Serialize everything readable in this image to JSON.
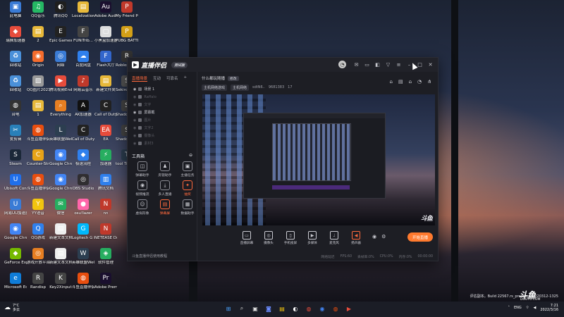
{
  "desktop": {
    "icons": [
      {
        "label": "此电脑",
        "color": "#3a7bd5",
        "glyph": "▣"
      },
      {
        "label": "QQ音乐",
        "color": "#25b864",
        "glyph": "♫"
      },
      {
        "label": "腾讯QQ",
        "color": "#1f1f1f",
        "glyph": "◐"
      },
      {
        "label": "Localization",
        "color": "#e8b93a",
        "glyph": "▤"
      },
      {
        "label": "Adobe Audit...",
        "color": "#1a0f2e",
        "glyph": "Au"
      },
      {
        "label": "My Friend Pedro",
        "color": "#c0392b",
        "glyph": "P"
      },
      {
        "label": "瑞狮加速器",
        "color": "#e74c3c",
        "glyph": "◆"
      },
      {
        "label": "2",
        "color": "#e8b93a",
        "glyph": "▤"
      },
      {
        "label": "Epic Games Launcher",
        "color": "#222",
        "glyph": "E"
      },
      {
        "label": "FUNiTrib...",
        "color": "#444",
        "glyph": "F"
      },
      {
        "label": "小黑盒加速器",
        "color": "#ddd",
        "glyph": "▢"
      },
      {
        "label": "PUBG BATTLEGR...",
        "color": "#d4a017",
        "glyph": "P"
      },
      {
        "label": "回收站",
        "color": "#4a90d9",
        "glyph": "♻"
      },
      {
        "label": "Origin",
        "color": "#f56c2d",
        "glyph": "◉"
      },
      {
        "label": "网络",
        "color": "#3a7bd5",
        "glyph": "◎"
      },
      {
        "label": "百度网盘",
        "color": "#2f80ed",
        "glyph": "☁"
      },
      {
        "label": "Flash大厅",
        "color": "#3366cc",
        "glyph": "F"
      },
      {
        "label": "Roblox Player",
        "color": "#333",
        "glyph": "R"
      },
      {
        "label": "回收站",
        "color": "#4a90d9",
        "glyph": "♻"
      },
      {
        "label": "QQ图片20210323...",
        "color": "#999",
        "glyph": "▨"
      },
      {
        "label": "腾讯视频End",
        "color": "#e74c3c",
        "glyph": "▶"
      },
      {
        "label": "网易云音乐",
        "color": "#c0392b",
        "glyph": "♪"
      },
      {
        "label": "新建文件夹",
        "color": "#e8b93a",
        "glyph": "▤"
      },
      {
        "label": "Sekiro Shadows...",
        "color": "#555",
        "glyph": "S"
      },
      {
        "label": "台电",
        "color": "#333",
        "glyph": "◍"
      },
      {
        "label": "1",
        "color": "#e8b93a",
        "glyph": "▤"
      },
      {
        "label": "Everything",
        "color": "#e67e22",
        "glyph": "⌕"
      },
      {
        "label": "AK加速器",
        "color": "#111",
        "glyph": "A"
      },
      {
        "label": "Call of Duty Black Op...",
        "color": "#222",
        "glyph": "C"
      },
      {
        "label": "Shadow Warrior 3",
        "color": "#444",
        "glyph": "S"
      },
      {
        "label": "爱剪辑",
        "color": "#2980b9",
        "glyph": "✂"
      },
      {
        "label": "斗鱼直播伴侣",
        "color": "#e84e0f",
        "glyph": "◍"
      },
      {
        "label": "英雄联盟WeGame",
        "color": "#2c3e50",
        "glyph": "L"
      },
      {
        "label": "Call of Duty Vanguard",
        "color": "#222",
        "glyph": "C"
      },
      {
        "label": "EA",
        "color": "#e74c3c",
        "glyph": "EA"
      },
      {
        "label": "Shadow Warrior 2",
        "color": "#444",
        "glyph": "S"
      },
      {
        "label": "Steam",
        "color": "#1b2838",
        "glyph": "S"
      },
      {
        "label": "Counter-Strike Global Of...",
        "color": "#e8a317",
        "glyph": "C"
      },
      {
        "label": "Google Chrome",
        "color": "#4285f4",
        "glyph": "◉"
      },
      {
        "label": "极速流程",
        "color": "#2f80ed",
        "glyph": "◆"
      },
      {
        "label": "加速器",
        "color": "#27ae60",
        "glyph": "⚡"
      },
      {
        "label": "tool Tsuba...",
        "color": "#2c3e50",
        "glyph": "T"
      },
      {
        "label": "Ubisoft Connect",
        "color": "#1f6feb",
        "glyph": "U"
      },
      {
        "label": "斗鱼直播伴侣工具",
        "color": "#e84e0f",
        "glyph": "◍"
      },
      {
        "label": "Google Chrome",
        "color": "#4285f4",
        "glyph": "◉"
      },
      {
        "label": "OBS Studio",
        "color": "#302e31",
        "glyph": "◎"
      },
      {
        "label": "腾讯文档",
        "color": "#2f80ed",
        "glyph": "▥"
      },
      {
        "label": "",
        "color": "transparent",
        "glyph": ""
      },
      {
        "label": "网易UU加速器",
        "color": "#3a7bd5",
        "glyph": "U"
      },
      {
        "label": "YY语音",
        "color": "#f1c40f",
        "glyph": "Y"
      },
      {
        "label": "微信",
        "color": "#27ae60",
        "glyph": "✉"
      },
      {
        "label": "osu!lazer",
        "color": "#ff66aa",
        "glyph": "●"
      },
      {
        "label": "nn",
        "color": "#c0392b",
        "glyph": "N"
      },
      {
        "label": "",
        "color": "transparent",
        "glyph": ""
      },
      {
        "label": "Google Chrome",
        "color": "#4285f4",
        "glyph": "◉"
      },
      {
        "label": "QQ游戏",
        "color": "#2f80ed",
        "glyph": "Q"
      },
      {
        "label": "新建文本文档.txt",
        "color": "#eee",
        "glyph": "▤"
      },
      {
        "label": "Logitech G HUB",
        "color": "#00b8fc",
        "glyph": "G"
      },
      {
        "label": "NETEASE Driver",
        "color": "#c0392b",
        "glyph": "N"
      },
      {
        "label": "",
        "color": "transparent",
        "glyph": ""
      },
      {
        "label": "GeForce Experience",
        "color": "#76b900",
        "glyph": "◆"
      },
      {
        "label": "游戏开放平台",
        "color": "#e67e22",
        "glyph": "◎"
      },
      {
        "label": "新建文本文档(2).txt",
        "color": "#eee",
        "glyph": "▤"
      },
      {
        "label": "英雄联盟WeGame",
        "color": "#2c3e50",
        "glyph": "W"
      },
      {
        "label": "软件管理",
        "color": "#27ae60",
        "glyph": "◈"
      },
      {
        "label": "",
        "color": "transparent",
        "glyph": ""
      },
      {
        "label": "Microsoft Edge",
        "color": "#0f7cd8",
        "glyph": "e"
      },
      {
        "label": "Randisp",
        "color": "#444",
        "glyph": "R"
      },
      {
        "label": "Key2Xinput",
        "color": "#444",
        "glyph": "K"
      },
      {
        "label": "斗鱼直播伴侣",
        "color": "#e84e0f",
        "glyph": "◍"
      },
      {
        "label": "Adobe Premie...",
        "color": "#1a0f2e",
        "glyph": "Pr"
      },
      {
        "label": "",
        "color": "transparent",
        "glyph": ""
      }
    ]
  },
  "app": {
    "title": "直播伴侣",
    "version_badge": "测试版",
    "tabs": [
      "直播场景",
      "互动",
      "可靠名"
    ],
    "scenes": [
      {
        "label": "场景 1",
        "dim": false
      },
      {
        "label": "Raffalo",
        "dim": true
      },
      {
        "label": "文字",
        "dim": true
      },
      {
        "label": "屏幕截",
        "dim": false
      },
      {
        "label": "图片",
        "dim": true
      },
      {
        "label": "文字2",
        "dim": true
      },
      {
        "label": "摄像头",
        "dim": true
      },
      {
        "label": "素材3",
        "dim": true
      }
    ],
    "toolbox_title": "工具箱",
    "tools": [
      {
        "label": "弹幕助手",
        "hot": false,
        "glyph": "◫"
      },
      {
        "label": "房管助手",
        "hot": false,
        "glyph": "♟"
      },
      {
        "label": "主播任务",
        "hot": false,
        "glyph": "▣"
      },
      {
        "label": "视频推流",
        "hot": false,
        "glyph": "◉"
      },
      {
        "label": "多人直播",
        "hot": false,
        "glyph": "⤓"
      },
      {
        "label": "抽奖",
        "hot": true,
        "glyph": "✦"
      },
      {
        "label": "虚拟形象",
        "hot": false,
        "glyph": "☺"
      },
      {
        "label": "弹幕屏",
        "hot": true,
        "glyph": "▤"
      },
      {
        "label": "数据助手",
        "hot": false,
        "glyph": "▦"
      }
    ],
    "footer_notice": "斗鱼直播伴侣使用教程",
    "room_title": "什么都玩随播",
    "room_chip": "修改",
    "room_tags": [
      "主机网络游戏",
      "主机网络"
    ],
    "room_stats": [
      "sdtN6..",
      "9681383",
      "17"
    ],
    "controls": [
      {
        "label": "直播屏幕",
        "hot": false,
        "glyph": "▭"
      },
      {
        "label": "摄像头",
        "hot": false,
        "glyph": "◎"
      },
      {
        "label": "手机投屏",
        "hot": false,
        "glyph": "▯"
      },
      {
        "label": "多媒体",
        "hot": false,
        "glyph": "▶"
      },
      {
        "label": "麦克风",
        "hot": false,
        "glyph": "♩"
      },
      {
        "label": "扬声器",
        "hot": true,
        "glyph": "◀"
      }
    ],
    "live_button": "开始直播",
    "status": [
      "网络延迟",
      "FPS:60",
      "丢帧率:0%",
      "CPU:0%",
      "内存:0%",
      "00:00:00"
    ],
    "watermark": "斗鱼"
  },
  "overlay": {
    "build_line": "评估副本。Build 22567.rs_prerelease.220312-1325",
    "logo": "斗鱼",
    "logo_sub": "DOUYU.COM"
  },
  "taskbar": {
    "weather_temp": "7°C",
    "weather_desc": "多云",
    "lang": "ENG",
    "time": "7:21",
    "date": "2022/3/16"
  }
}
